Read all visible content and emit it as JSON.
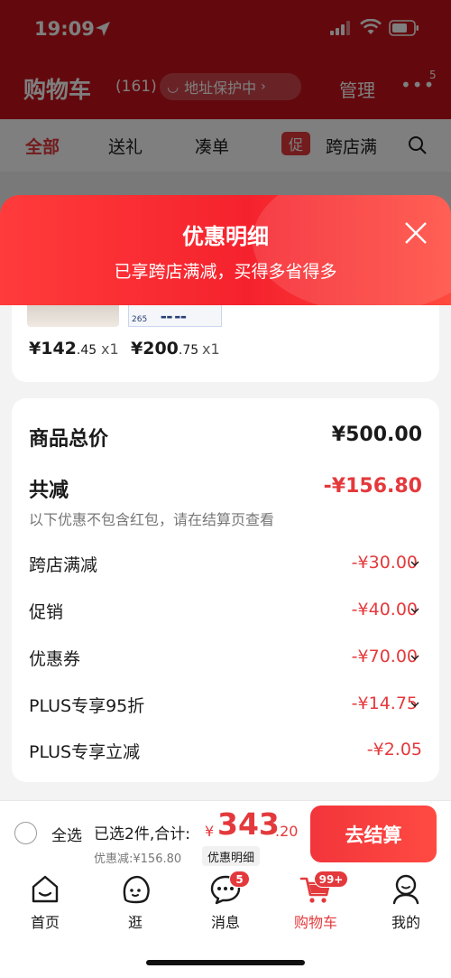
{
  "status_bar": {
    "time": "19:09"
  },
  "cart_header": {
    "title": "购物车",
    "count": "(161)",
    "address_pill": "地址保护中",
    "manage": "管理",
    "more_badge": "5"
  },
  "tabs": [
    {
      "label": "全部"
    },
    {
      "label": "送礼"
    },
    {
      "label": "凑单"
    },
    {
      "badge": "促",
      "label": "跨店满"
    }
  ],
  "sheet": {
    "title": "优惠明细",
    "subtitle": "已享跨店满减，买得多省得多"
  },
  "products": [
    {
      "price_int": "¥142",
      "price_dec": ".45",
      "qty": "x1"
    },
    {
      "price_int": "¥200",
      "price_dec": ".75",
      "qty": "x1",
      "thumb_text": "265"
    }
  ],
  "summary": {
    "total_label": "商品总价",
    "total_value": "¥500.00",
    "reduce_label": "共减",
    "reduce_value": "-¥156.80",
    "note": "以下优惠不包含红包，请在结算页查看",
    "items": [
      {
        "label": "跨店满减",
        "value": "-¥30.00"
      },
      {
        "label": "促销",
        "value": "-¥40.00"
      },
      {
        "label": "优惠券",
        "value": "-¥70.00"
      },
      {
        "label": "PLUS专享95折",
        "value": "-¥14.75"
      },
      {
        "label": "PLUS专享立减",
        "value": "-¥2.05"
      }
    ]
  },
  "checkout": {
    "select_all": "全选",
    "selected_info": "已选2件,合计:",
    "currency": "¥",
    "total_int": "343",
    "total_dec": ".20",
    "discount_line": "优惠减:¥156.80",
    "discount_detail": "优惠明细",
    "button": "去结算"
  },
  "nav": [
    {
      "label": "首页",
      "icon": "home-icon"
    },
    {
      "label": "逛",
      "icon": "face-icon"
    },
    {
      "label": "消息",
      "icon": "message-icon",
      "badge": "5"
    },
    {
      "label": "购物车",
      "icon": "cart-icon",
      "badge": "99+"
    },
    {
      "label": "我的",
      "icon": "profile-icon"
    }
  ],
  "colors": {
    "accent": "#e4393c",
    "header_bg": "#c7121a"
  }
}
